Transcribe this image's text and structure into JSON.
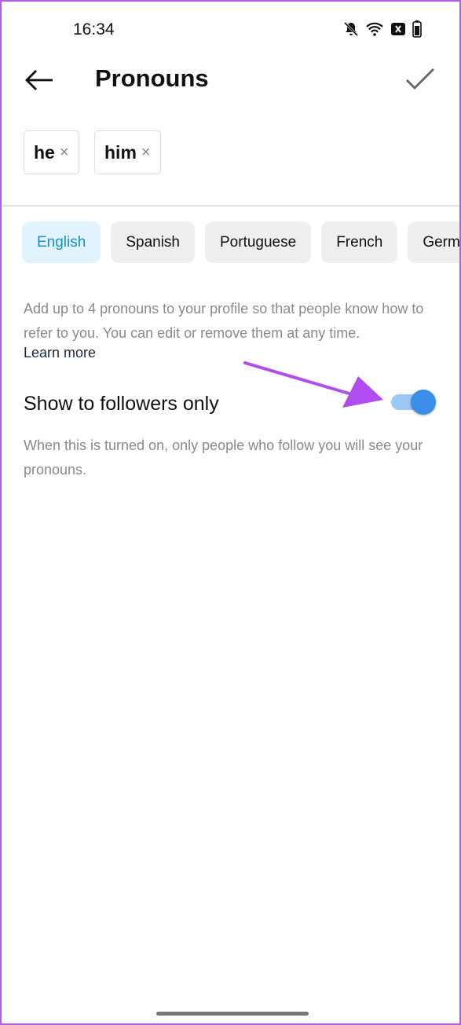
{
  "status_bar": {
    "time": "16:34",
    "icons": [
      "bell-off-icon",
      "wifi-icon",
      "no-sim-icon",
      "battery-icon"
    ]
  },
  "header": {
    "title": "Pronouns",
    "back_icon": "arrow-left-icon",
    "confirm_icon": "check-icon"
  },
  "pronouns": [
    {
      "label": "he",
      "remove": "×"
    },
    {
      "label": "him",
      "remove": "×"
    }
  ],
  "languages": [
    {
      "label": "English",
      "selected": true
    },
    {
      "label": "Spanish"
    },
    {
      "label": "Portuguese"
    },
    {
      "label": "French"
    },
    {
      "label": "German"
    }
  ],
  "description": "Add up to 4 pronouns to your profile so that people know how to refer to you. You can edit or remove them at any time.",
  "learn_more": "Learn more",
  "setting": {
    "label": "Show to followers only",
    "enabled": true,
    "description": "When this is turned on, only people who follow you will see your pronouns."
  },
  "colors": {
    "accent": "#3b8fe8",
    "annotation_arrow": "#b04cf0",
    "selected_chip_text": "#1a8fc7"
  }
}
